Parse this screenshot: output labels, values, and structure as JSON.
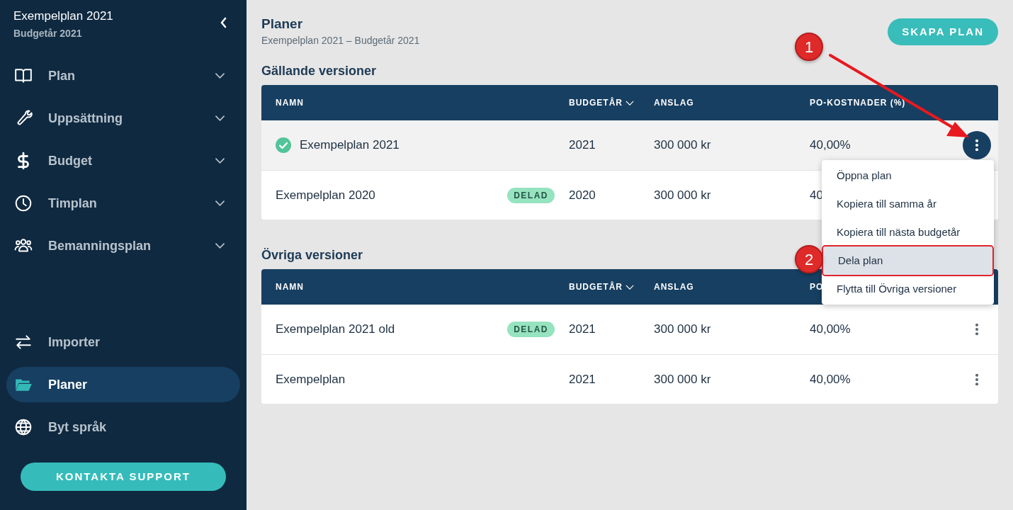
{
  "sidebar": {
    "plan_title": "Exempelplan 2021",
    "plan_subtitle": "Budgetår 2021",
    "menu": [
      {
        "label": "Plan",
        "expandable": true,
        "selected": false
      },
      {
        "label": "Uppsättning",
        "expandable": true,
        "selected": false
      },
      {
        "label": "Budget",
        "expandable": true,
        "selected": false
      },
      {
        "label": "Timplan",
        "expandable": true,
        "selected": false
      },
      {
        "label": "Bemanningsplan",
        "expandable": true,
        "selected": false
      }
    ],
    "bottom_menu": [
      {
        "label": "Importer",
        "selected": false
      },
      {
        "label": "Planer",
        "selected": true
      },
      {
        "label": "Byt språk",
        "selected": false
      }
    ],
    "support_button": "KONTAKTA SUPPORT"
  },
  "header": {
    "title": "Planer",
    "breadcrumb": "Exempelplan 2021 – Budgetår 2021",
    "create_button": "SKAPA PLAN"
  },
  "sections": [
    {
      "title": "Gällande versioner",
      "columns": [
        {
          "label": "NAMN",
          "sortable": false
        },
        {
          "label": "BUDGETÅR",
          "sortable": true
        },
        {
          "label": "ANSLAG",
          "sortable": false
        },
        {
          "label": "PO-KOSTNADER (%)",
          "sortable": false
        }
      ],
      "rows": [
        {
          "name": "Exempelplan 2021",
          "active": true,
          "highlighted": true,
          "year": "2021",
          "grant": "300 000 kr",
          "po": "40,00%",
          "menu_open": true
        },
        {
          "name": "Exempelplan 2020",
          "active": false,
          "highlighted": false,
          "badge": "DELAD",
          "year": "2020",
          "grant": "300 000 kr",
          "po": "40"
        }
      ]
    },
    {
      "title": "Övriga versioner",
      "columns": [
        {
          "label": "NAMN",
          "sortable": false
        },
        {
          "label": "BUDGETÅR",
          "sortable": true
        },
        {
          "label": "ANSLAG",
          "sortable": false
        },
        {
          "label": "PO"
        }
      ],
      "rows": [
        {
          "name": "Exempelplan 2021 old",
          "active": false,
          "highlighted": false,
          "badge": "DELAD",
          "year": "2021",
          "grant": "300 000 kr",
          "po": "40,00%",
          "menu_open": false
        },
        {
          "name": "Exempelplan",
          "active": false,
          "highlighted": false,
          "year": "2021",
          "grant": "300 000 kr",
          "po": "40,00%",
          "menu_open": false
        }
      ]
    }
  ],
  "context_menu": [
    {
      "label": "Öppna plan",
      "selected": false
    },
    {
      "label": "Kopiera till samma år",
      "selected": false
    },
    {
      "label": "Kopiera till nästa budgetår",
      "selected": false
    },
    {
      "label": "Dela plan",
      "selected": true,
      "outlined": true
    },
    {
      "label": "Flytta till Övriga versioner",
      "selected": false
    }
  ],
  "callouts": [
    {
      "number": "1"
    },
    {
      "number": "2"
    }
  ]
}
